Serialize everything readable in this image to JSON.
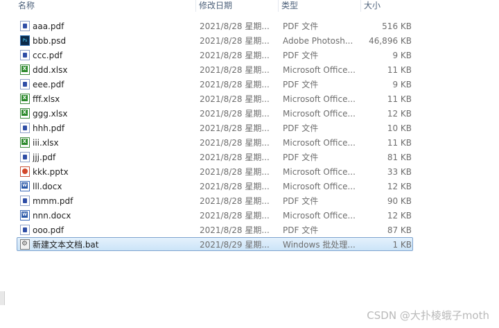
{
  "columns": {
    "name": "名称",
    "date": "修改日期",
    "type": "类型",
    "size": "大小"
  },
  "files": [
    {
      "name": "aaa.pdf",
      "date": "2021/8/28 星期...",
      "type": "PDF 文件",
      "size": "516 KB",
      "icon": "pdf-file-icon"
    },
    {
      "name": "bbb.psd",
      "date": "2021/8/28 星期...",
      "type": "Adobe Photosh...",
      "size": "46,896 KB",
      "icon": "psd-file-icon"
    },
    {
      "name": "ccc.pdf",
      "date": "2021/8/28 星期...",
      "type": "PDF 文件",
      "size": "9 KB",
      "icon": "pdf-file-icon"
    },
    {
      "name": "ddd.xlsx",
      "date": "2021/8/28 星期...",
      "type": "Microsoft Office...",
      "size": "11 KB",
      "icon": "excel-file-icon"
    },
    {
      "name": "eee.pdf",
      "date": "2021/8/28 星期...",
      "type": "PDF 文件",
      "size": "9 KB",
      "icon": "pdf-file-icon"
    },
    {
      "name": "fff.xlsx",
      "date": "2021/8/28 星期...",
      "type": "Microsoft Office...",
      "size": "11 KB",
      "icon": "excel-file-icon"
    },
    {
      "name": "ggg.xlsx",
      "date": "2021/8/28 星期...",
      "type": "Microsoft Office...",
      "size": "12 KB",
      "icon": "excel-file-icon"
    },
    {
      "name": "hhh.pdf",
      "date": "2021/8/28 星期...",
      "type": "PDF 文件",
      "size": "10 KB",
      "icon": "pdf-file-icon"
    },
    {
      "name": "iii.xlsx",
      "date": "2021/8/28 星期...",
      "type": "Microsoft Office...",
      "size": "11 KB",
      "icon": "excel-file-icon"
    },
    {
      "name": "jjj.pdf",
      "date": "2021/8/28 星期...",
      "type": "PDF 文件",
      "size": "81 KB",
      "icon": "pdf-file-icon"
    },
    {
      "name": "kkk.pptx",
      "date": "2021/8/28 星期...",
      "type": "Microsoft Office...",
      "size": "33 KB",
      "icon": "powerpoint-file-icon"
    },
    {
      "name": "lll.docx",
      "date": "2021/8/28 星期...",
      "type": "Microsoft Office...",
      "size": "12 KB",
      "icon": "word-file-icon"
    },
    {
      "name": "mmm.pdf",
      "date": "2021/8/28 星期...",
      "type": "PDF 文件",
      "size": "90 KB",
      "icon": "pdf-file-icon"
    },
    {
      "name": "nnn.docx",
      "date": "2021/8/28 星期...",
      "type": "Microsoft Office...",
      "size": "12 KB",
      "icon": "word-file-icon"
    },
    {
      "name": "ooo.pdf",
      "date": "2021/8/28 星期...",
      "type": "PDF 文件",
      "size": "87 KB",
      "icon": "pdf-file-icon"
    },
    {
      "name": "新建文本文档.bat",
      "date": "2021/8/29 星期...",
      "type": "Windows 批处理...",
      "size": "1 KB",
      "icon": "batch-file-icon",
      "selected": true
    }
  ],
  "watermark": "CSDN @大扑棱蛾子moth",
  "colors": {
    "header_text": "#4c607a",
    "selection_border": "#7da2ce",
    "selection_fill": "#cce4f8",
    "secondary_text": "#6d6d6d"
  }
}
